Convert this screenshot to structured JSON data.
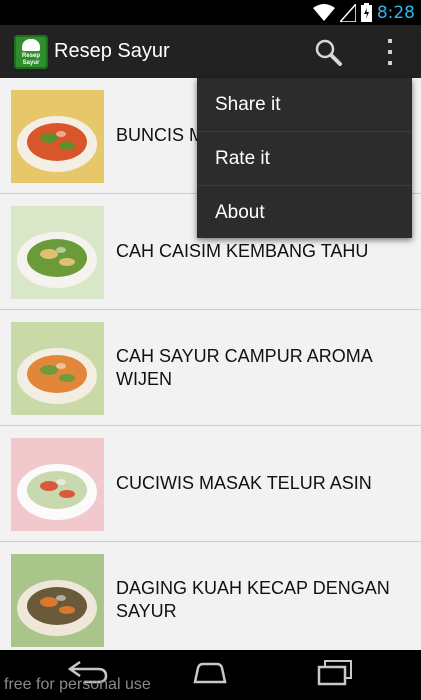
{
  "status_bar": {
    "time": "8:28",
    "icons": [
      "wifi-icon",
      "signal-icon",
      "battery-charging-icon"
    ]
  },
  "action_bar": {
    "app_title": "Resep Sayur",
    "app_icon_text": "Resep Sayur",
    "actions": [
      "search-icon",
      "overflow-menu-icon"
    ]
  },
  "recipes": [
    {
      "title": "BUNCIS MASAK TAHU",
      "thumb": {
        "plate": "#f4efe4",
        "food": "#d8562a",
        "accent": "#5f8f2c",
        "bg": "#e6c76a"
      }
    },
    {
      "title": "CAH CAISIM KEMBANG TAHU",
      "thumb": {
        "plate": "#f5f3ee",
        "food": "#6a9a3a",
        "accent": "#e0c070",
        "bg": "#d9e7c8"
      }
    },
    {
      "title": "CAH SAYUR CAMPUR AROMA WIJEN",
      "thumb": {
        "plate": "#f2eee4",
        "food": "#e2863a",
        "accent": "#6f9a3e",
        "bg": "#c9d9a8"
      }
    },
    {
      "title": "CUCIWIS MASAK TELUR ASIN",
      "thumb": {
        "plate": "#fbfbfb",
        "food": "#c8d9b0",
        "accent": "#d85a3a",
        "bg": "#f1c9cd"
      }
    },
    {
      "title": "DAGING KUAH KECAP DENGAN SAYUR",
      "thumb": {
        "plate": "#efe8da",
        "food": "#6b5a3a",
        "accent": "#d9782e",
        "bg": "#a9c58a"
      }
    }
  ],
  "overflow_menu": {
    "items": [
      "Share it",
      "Rate it",
      "About"
    ]
  },
  "nav_bar": {
    "buttons": [
      "back-icon",
      "home-icon",
      "recent-apps-icon"
    ]
  },
  "watermark": "free for personal use"
}
